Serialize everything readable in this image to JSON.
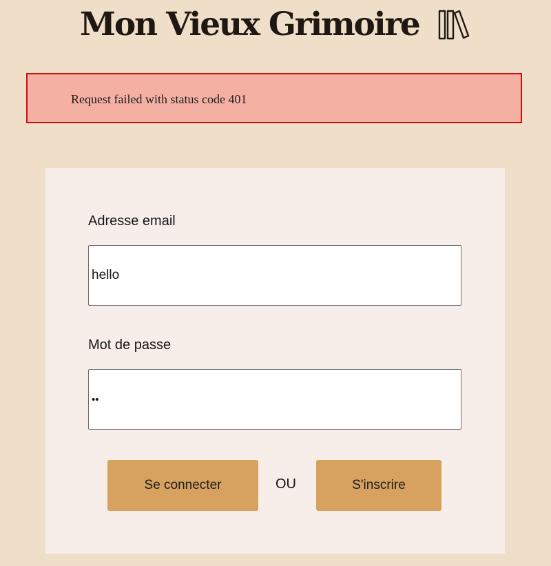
{
  "header": {
    "title": "Mon Vieux Grimoire",
    "logo_icon": "books-icon"
  },
  "error": {
    "message": "Request failed with status code 401",
    "border_color": "#d00e0e",
    "background_color": "#f5b0a4"
  },
  "login_form": {
    "email_label": "Adresse email",
    "email_value": "hello",
    "password_label": "Mot de passe",
    "password_value": "••",
    "login_button_label": "Se connecter",
    "separator": "OU",
    "signup_button_label": "S'inscrire"
  },
  "colors": {
    "page_background": "#efdfc8",
    "card_background": "#f7eee9",
    "button_background": "#d7a15f",
    "title_color": "#1f1712"
  }
}
